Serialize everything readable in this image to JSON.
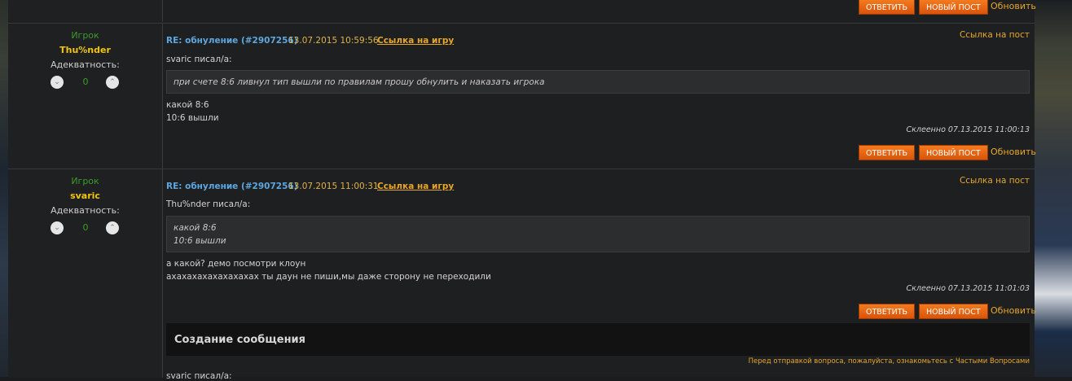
{
  "top_actions": {
    "reply_label": "ОТВЕТИТЬ",
    "new_post_label": "НОВЫЙ ПОСТ",
    "refresh_label": "Обновить"
  },
  "posts": [
    {
      "role": "Игрок",
      "username": "Thu%nder",
      "adequacy_label": "Адекватность:",
      "vote_down": "⌄",
      "vote_up": "⌃",
      "vote_count": "0",
      "title": "RE: обнуление (#2907256)",
      "datetime": "13.07.2015 10:59:56",
      "game_link": "Ссылка на игру",
      "post_link": "Ссылка на пост",
      "quote_author": "svaric писал/а:",
      "quote_lines": [
        "при счете 8:6 ливнул тип вышли по правилам прошу обнулить и наказать игрока"
      ],
      "message_lines": [
        "какой 8:6",
        "10:6 вышли"
      ],
      "edited": "Склеенно 07.13.2015 11:00:13",
      "reply_label": "ОТВЕТИТЬ",
      "new_post_label": "НОВЫЙ ПОСТ",
      "refresh_label": "Обновить"
    },
    {
      "role": "Игрок",
      "username": "svaric",
      "adequacy_label": "Адекватность:",
      "vote_down": "⌄",
      "vote_up": "⌃",
      "vote_count": "0",
      "title": "RE: обнуление (#2907256)",
      "datetime": "13.07.2015 11:00:31",
      "game_link": "Ссылка на игру",
      "post_link": "Ссылка на пост",
      "quote_author": "Thu%nder писал/а:",
      "quote_lines": [
        "какой 8:6",
        "10:6 вышли"
      ],
      "message_lines": [
        "а какой? демо посмотри клоун",
        "ахахахахахахахахах ты даун не пиши,мы даже сторону не переходили"
      ],
      "edited": "Склеенно 07.13.2015 11:01:03",
      "reply_label": "ОТВЕТИТЬ",
      "new_post_label": "НОВЫЙ ПОСТ",
      "refresh_label": "Обновить"
    }
  ],
  "compose": {
    "title": "Создание сообщения",
    "faq_note": "Перед отправкой вопроса, пожалуйста, ознакомьтесь с Частыми Вопросами",
    "partial_quote": "svaric писал/а:"
  },
  "colors": {
    "accent_orange": "#e6a72a",
    "button_orange": "#f57a1e",
    "role_green": "#3c9b2a",
    "username_yellow": "#f1c40f",
    "title_blue": "#5da7e0"
  }
}
